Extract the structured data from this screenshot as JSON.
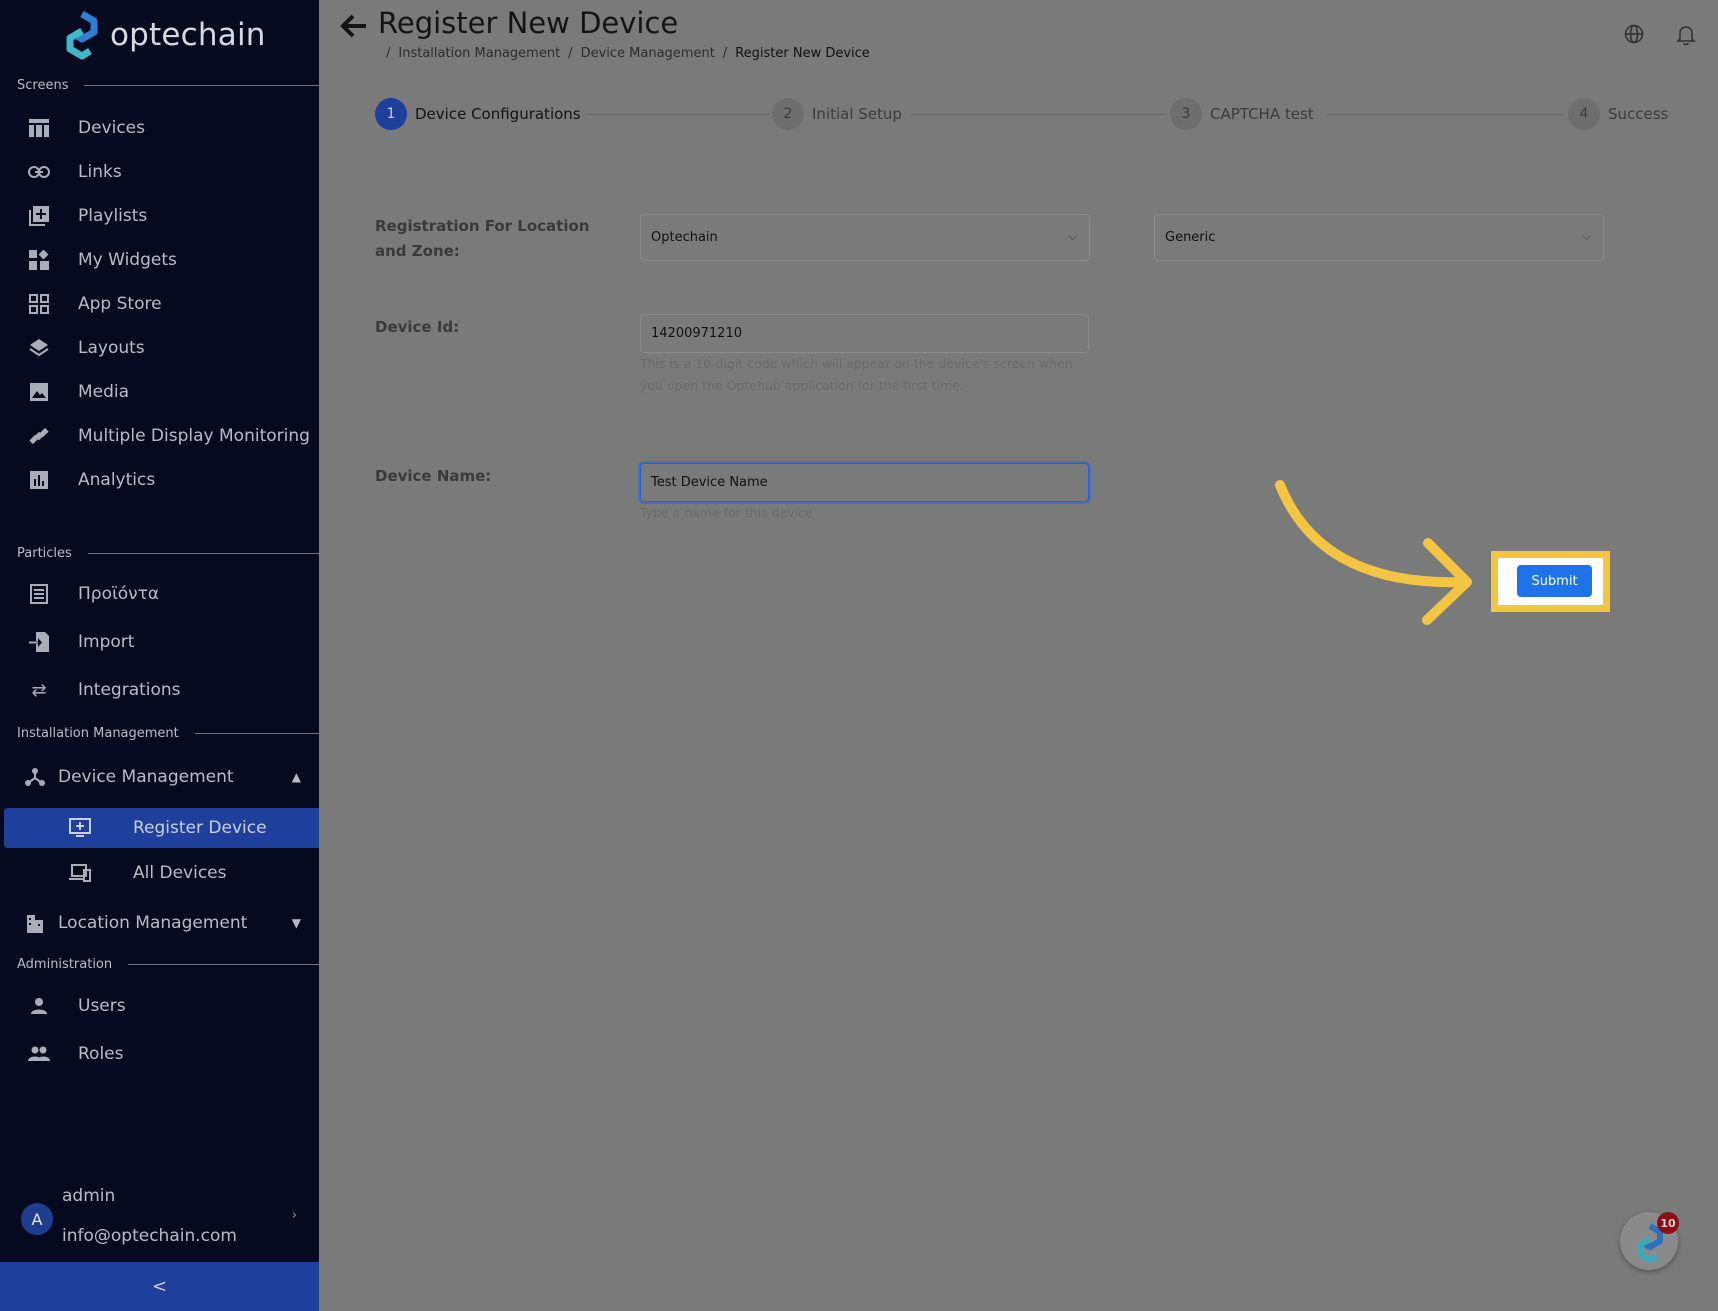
{
  "app": {
    "name": "optechain"
  },
  "sidebar": {
    "sections": {
      "screens": "Screens",
      "particles": "Particles",
      "installation": "Installation Management",
      "administration": "Administration"
    },
    "items": {
      "devices": "Devices",
      "links": "Links",
      "playlists": "Playlists",
      "my_widgets": "My Widgets",
      "app_store": "App Store",
      "layouts": "Layouts",
      "media": "Media",
      "multiple_display": "Multiple Display Monitoring",
      "analytics": "Analytics",
      "products": "Προϊόντα",
      "import": "Import",
      "integrations": "Integrations",
      "device_management": "Device Management",
      "register_device": "Register Device",
      "all_devices": "All Devices",
      "location_management": "Location Management",
      "users": "Users",
      "roles": "Roles"
    },
    "user": {
      "initial": "A",
      "name": "admin",
      "email": "info@optechain.com"
    },
    "collapse_label": "<"
  },
  "header": {
    "title": "Register New Device",
    "breadcrumb": [
      "Installation Management",
      "Device Management",
      "Register New Device"
    ],
    "breadcrumb_sep": "/"
  },
  "steps": [
    {
      "num": "1",
      "label": "Device Configurations"
    },
    {
      "num": "2",
      "label": "Initial Setup"
    },
    {
      "num": "3",
      "label": "CAPTCHA test"
    },
    {
      "num": "4",
      "label": "Success"
    }
  ],
  "form": {
    "location_label": "Registration For Location and Zone:",
    "location_value": "Optechain",
    "zone_value": "Generic",
    "device_id_label": "Device Id:",
    "device_id_value": "14200971210",
    "device_id_help": "This is a 10-digit code which will appear on the device's screen when you open the Optehub application for the first time.",
    "device_name_label": "Device Name:",
    "device_name_value": "Test Device Name",
    "device_name_help": "Type a name for this device",
    "submit_label": "Submit"
  },
  "fab": {
    "badge": "10"
  },
  "colors": {
    "sidebar_bg": "#050a1f",
    "active_item": "#1e3f9c",
    "submit": "#1e73e8",
    "highlight": "#f4c542",
    "overlay_bg": "#7a7a7a"
  }
}
